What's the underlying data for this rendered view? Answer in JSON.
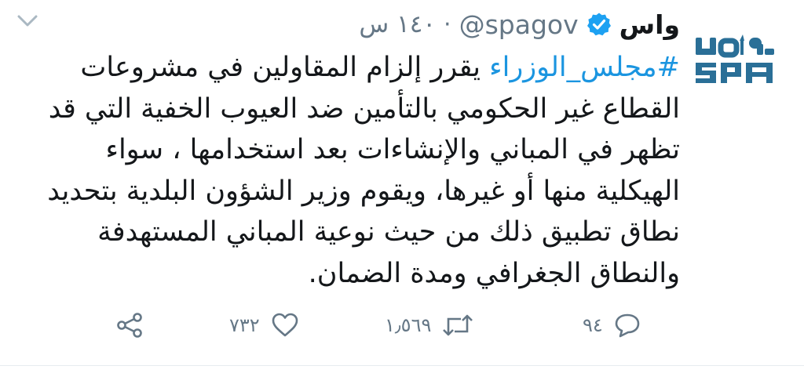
{
  "tweet": {
    "display_name": "واس",
    "handle": "@spagov",
    "separator": "·",
    "time": "١٤٠ س",
    "avatar_icon": "spa-logo",
    "verified_icon": "verified-badge-icon",
    "lines": [
      {
        "hashtag": "#مجلس_الوزراء",
        "text": " يقرر إلزام المقاولين في مشروعات"
      },
      {
        "hashtag": "",
        "text": "القطاع غير الحكومي بالتأمين ضد العيوب الخفية التي قد"
      },
      {
        "hashtag": "",
        "text": "تظهر في المباني والإنشاءات بعد استخدامها ، سواء"
      },
      {
        "hashtag": "",
        "text": "الهيكلية منها أو غيرها، ويقوم وزير الشؤون البلدية بتحديد"
      },
      {
        "hashtag": "",
        "text": "نطاق تطبيق ذلك من حيث نوعية المباني المستهدفة"
      },
      {
        "hashtag": "",
        "text": "والنطاق الجغرافي ومدة الضمان."
      }
    ]
  },
  "actions": {
    "reply_count": "٩٤",
    "retweet_count": "١٫٥٦٩",
    "like_count": "٧٣٢"
  },
  "colors": {
    "text": "#14171a",
    "secondary": "#657786",
    "link": "#1b95e0",
    "logo": "#2a6f97",
    "verified": "#1da1f2"
  }
}
